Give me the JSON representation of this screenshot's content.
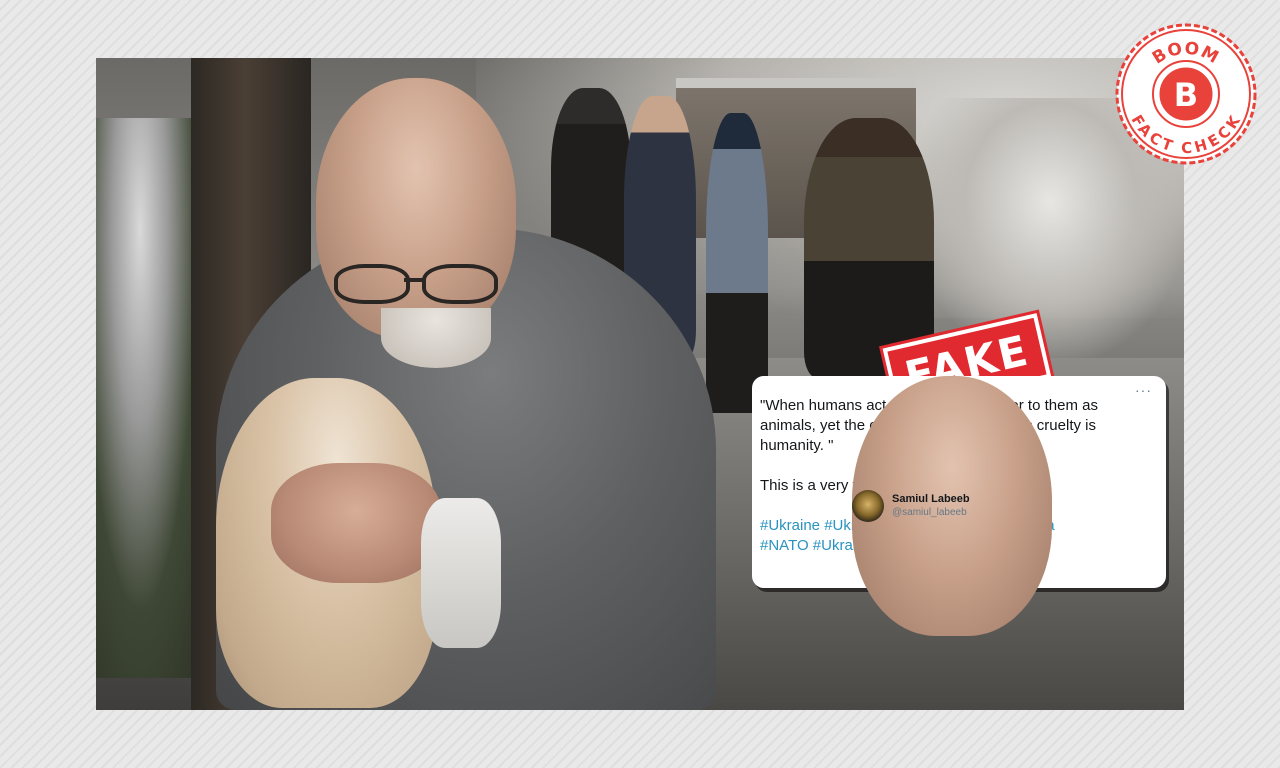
{
  "badge": {
    "top_text": "BOOM",
    "letter": "B",
    "bottom_text": "FACT CHECK",
    "color": "#e8423b"
  },
  "stamp": {
    "text": "FAKE",
    "color": "#e02a2f"
  },
  "tweet": {
    "display_name": "Samiul Labeeb",
    "handle": "@samiul_labeeb",
    "more": "···",
    "quote": "\"When humans act with cruelty we refer to them as animals, yet the only animal that displays cruelty is humanity. \"",
    "line2": "This is a very touching image",
    "heart": "❤",
    "hashtags_line1": "#Ukraine #UkraineRussianWar #StopRussia",
    "hashtags_line2": "#NATO #UkraineRussia",
    "link_color": "#2a93c1"
  },
  "photo": {
    "subject": "elderly man holding a cat in snowy damaged street"
  }
}
